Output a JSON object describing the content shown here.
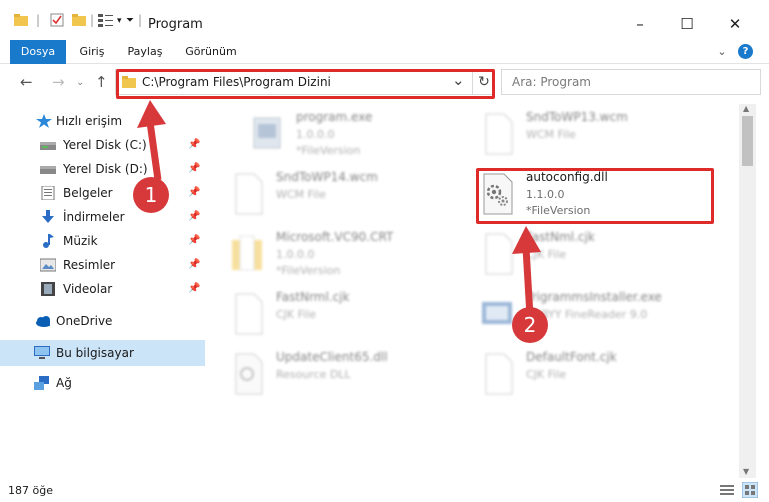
{
  "window": {
    "title": "Program",
    "minimize": "–",
    "maximize": "☐",
    "close": "✕"
  },
  "ribbon": {
    "tabs": [
      "Dosya",
      "Giriş",
      "Paylaş",
      "Görünüm"
    ],
    "expand": "⌄",
    "help": "?"
  },
  "nav": {
    "back": "←",
    "forward": "→",
    "up": "↑",
    "address": "C:\\Program Files\\Program Dizini",
    "address_dropdown": "⌄",
    "refresh": "↻",
    "search_placeholder": "Ara: Program"
  },
  "sidebar": {
    "items": [
      {
        "label": "Hızlı erişim",
        "icon": "star-icon"
      },
      {
        "label": "Yerel Disk (C:)",
        "icon": "disk-icon"
      },
      {
        "label": "Yerel Disk (D:)",
        "icon": "disk-icon"
      },
      {
        "label": "Belgeler",
        "icon": "documents-icon"
      },
      {
        "label": "İndirmeler",
        "icon": "download-icon"
      },
      {
        "label": "Müzik",
        "icon": "music-icon"
      },
      {
        "label": "Resimler",
        "icon": "pictures-icon"
      },
      {
        "label": "Videolar",
        "icon": "video-icon"
      },
      {
        "label": "OneDrive",
        "icon": "cloud-icon"
      },
      {
        "label": "Bu bilgisayar",
        "icon": "computer-icon"
      },
      {
        "label": "Ağ",
        "icon": "network-icon"
      }
    ],
    "pin": "📌"
  },
  "files": [
    {
      "name": "program.exe",
      "line1": "1.0.0.0",
      "line2": "*FileVersion"
    },
    {
      "name": "SndToWP13.wcm",
      "line1": "WCM File",
      "line2": ""
    },
    {
      "name": "SndToWP14.wcm",
      "line1": "WCM File",
      "line2": ""
    },
    {
      "name": "autoconfig.dll",
      "line1": "1.1.0.0",
      "line2": "*FileVersion"
    },
    {
      "name": "Microsoft.VC90.CRT",
      "line1": "1.0.0.0",
      "line2": "*FileVersion"
    },
    {
      "name": "FastNml.cjk",
      "line1": "CJK File",
      "line2": ""
    },
    {
      "name": "FastNrml.cjk",
      "line1": "CJK File",
      "line2": ""
    },
    {
      "name": "TrigrammsInstaller.exe",
      "line1": "ABBYY FineReader 9.0",
      "line2": ""
    },
    {
      "name": "UpdateClient65.dll",
      "line1": "Resource DLL",
      "line2": ""
    },
    {
      "name": "DefaultFont.cjk",
      "line1": "CJK File",
      "line2": ""
    }
  ],
  "status": {
    "count": "187 öğe"
  },
  "callouts": [
    "1",
    "2"
  ],
  "colors": {
    "accent": "#1979ca",
    "highlight": "#df2a2a",
    "callout": "#d7393b",
    "selected": "#cce4f7"
  }
}
